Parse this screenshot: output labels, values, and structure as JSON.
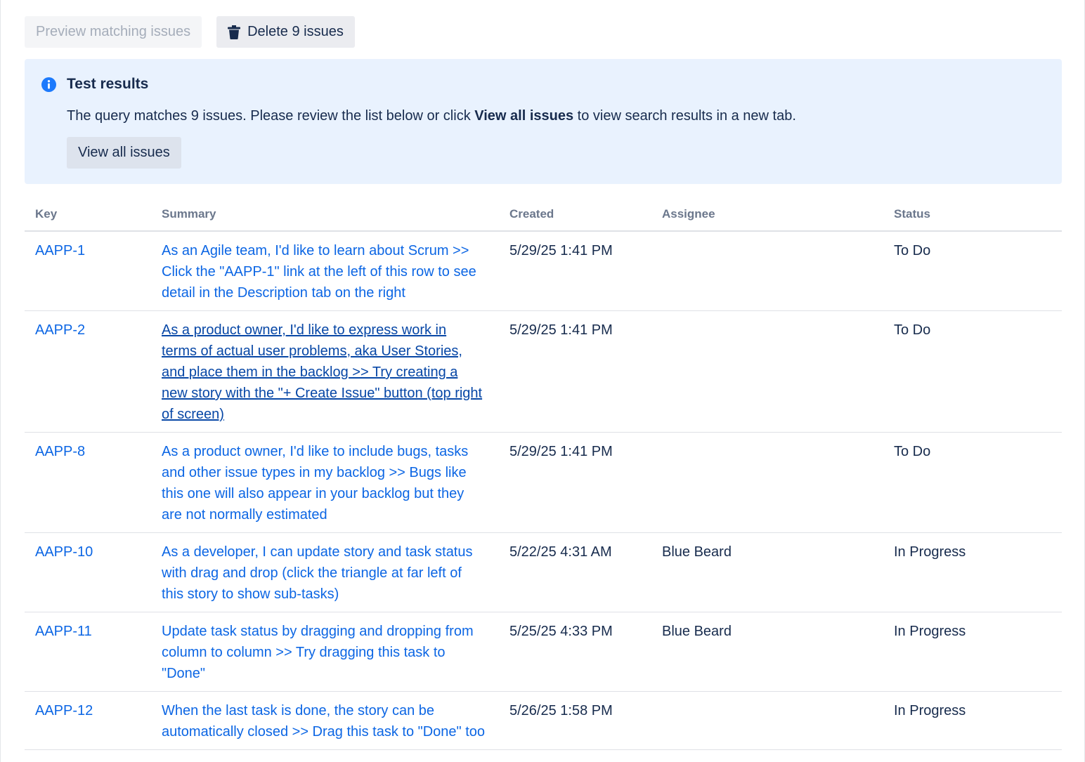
{
  "toolbar": {
    "preview_label": "Preview matching issues",
    "delete_label": "Delete 9 issues"
  },
  "info": {
    "title": "Test results",
    "text_before": "The query matches 9 issues. Please review the list below or click ",
    "text_bold": "View all issues",
    "text_after": " to view search results in a new tab.",
    "view_all_label": "View all issues"
  },
  "table": {
    "headers": {
      "key": "Key",
      "summary": "Summary",
      "created": "Created",
      "assignee": "Assignee",
      "status": "Status"
    },
    "rows": [
      {
        "key": "AAPP-1",
        "summary": "As an Agile team, I'd like to learn about Scrum >> Click the \"AAPP-1\" link at the left of this row to see detail in the Description tab on the right",
        "created": "5/29/25 1:41 PM",
        "assignee": "",
        "status": "To Do"
      },
      {
        "key": "AAPP-2",
        "summary": "As a product owner, I'd like to express work in terms of actual user problems, aka User Stories, and place them in the backlog >> Try creating a new story with the \"+ Create Issue\" button (top right of screen)",
        "created": "5/29/25 1:41 PM",
        "assignee": "",
        "status": "To Do"
      },
      {
        "key": "AAPP-8",
        "summary": "As a product owner, I'd like to include bugs, tasks and other issue types in my backlog >> Bugs like this one will also appear in your backlog but they are not normally estimated",
        "created": "5/29/25 1:41 PM",
        "assignee": "",
        "status": "To Do"
      },
      {
        "key": "AAPP-10",
        "summary": "As a developer, I can update story and task status with drag and drop (click the triangle at far left of this story to show sub-tasks)",
        "created": "5/22/25 4:31 AM",
        "assignee": "Blue Beard",
        "status": "In Progress"
      },
      {
        "key": "AAPP-11",
        "summary": "Update task status by dragging and dropping from column to column >> Try dragging this task to \"Done\"",
        "created": "5/25/25 4:33 PM",
        "assignee": "Blue Beard",
        "status": "In Progress"
      },
      {
        "key": "AAPP-12",
        "summary": "When the last task is done, the story can be automatically closed >> Drag this task to \"Done\" too",
        "created": "5/26/25 1:58 PM",
        "assignee": "",
        "status": "In Progress"
      }
    ]
  },
  "colors": {
    "link": "#0c66e4",
    "link_hover": "#0747a6",
    "info_background": "#e9f2fe",
    "info_icon": "#1d7afc",
    "text": "#172b4d",
    "header_text": "#6b778c"
  },
  "icons": {
    "delete": "trash-icon",
    "info": "info-icon"
  }
}
